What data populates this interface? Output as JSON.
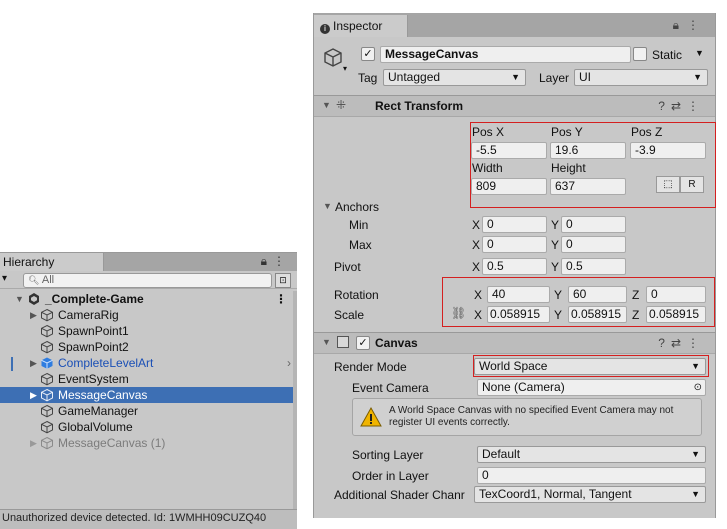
{
  "hierarchy": {
    "tab_label": "Hierarchy",
    "search_placeholder": "All",
    "items": [
      {
        "label": "_Complete-Game"
      },
      {
        "label": "CameraRig"
      },
      {
        "label": "SpawnPoint1"
      },
      {
        "label": "SpawnPoint2"
      },
      {
        "label": "CompleteLevelArt"
      },
      {
        "label": "EventSystem"
      },
      {
        "label": "MessageCanvas"
      },
      {
        "label": "GameManager"
      },
      {
        "label": "GlobalVolume"
      },
      {
        "label": "MessageCanvas (1)"
      }
    ],
    "scene_menu": "⋮"
  },
  "status_bar": {
    "text": "Unauthorized device detected. Id: 1WMHH09CUZQ40"
  },
  "inspector": {
    "tab_label": "Inspector",
    "object_name": "MessageCanvas",
    "static_label": "Static",
    "tag_label": "Tag",
    "tag_value": "Untagged",
    "layer_label": "Layer",
    "layer_value": "UI",
    "rect_transform": {
      "title": "Rect Transform",
      "pos_x_label": "Pos X",
      "pos_x": "-5.5",
      "pos_y_label": "Pos Y",
      "pos_y": "19.6",
      "pos_z_label": "Pos Z",
      "pos_z": "-3.9",
      "width_label": "Width",
      "width": "809",
      "height_label": "Height",
      "height": "637",
      "raw_button": "R",
      "anchors_label": "Anchors",
      "min_label": "Min",
      "min_x": "0",
      "min_y": "0",
      "max_label": "Max",
      "max_x": "0",
      "max_y": "0",
      "pivot_label": "Pivot",
      "pivot_x": "0.5",
      "pivot_y": "0.5",
      "rotation_label": "Rotation",
      "rot_x": "40",
      "rot_y": "60",
      "rot_z": "0",
      "scale_label": "Scale",
      "scale_x": "0.058915",
      "scale_y": "0.058915",
      "scale_z": "0.058915",
      "x_label": "X",
      "y_label": "Y",
      "z_label": "Z"
    },
    "canvas": {
      "title": "Canvas",
      "render_mode_label": "Render Mode",
      "render_mode_value": "World Space",
      "event_camera_label": "Event Camera",
      "event_camera_value": "None (Camera)",
      "warning_text": "A World Space Canvas with no specified Event Camera may not register UI events correctly.",
      "sorting_layer_label": "Sorting Layer",
      "sorting_layer_value": "Default",
      "order_in_layer_label": "Order in Layer",
      "order_in_layer_value": "0",
      "shader_channels_label": "Additional Shader Chanr",
      "shader_channels_value": "TexCoord1, Normal, Tangent"
    }
  },
  "colors": {
    "selection": "#3d6fb4",
    "highlight_box": "#d42020",
    "panel_bg": "#c8c8c8"
  }
}
